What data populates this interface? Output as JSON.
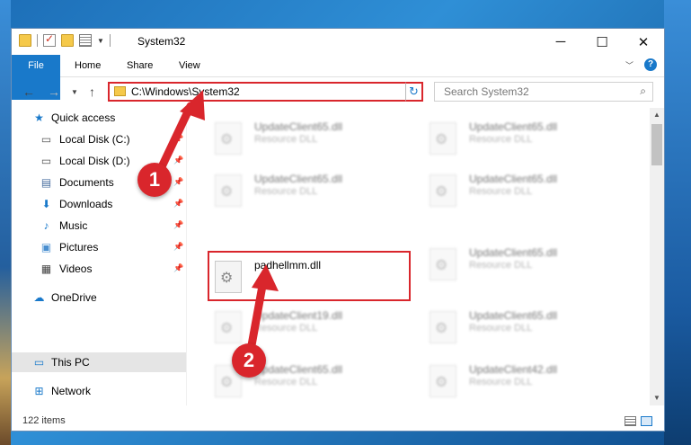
{
  "window": {
    "title": "System32",
    "controls": {
      "minimize": "─",
      "maximize": "☐",
      "close": "✕"
    }
  },
  "ribbon": {
    "tabs": [
      {
        "label": "File"
      },
      {
        "label": "Home"
      },
      {
        "label": "Share"
      },
      {
        "label": "View"
      }
    ],
    "help": "?"
  },
  "nav": {
    "address": "C:\\Windows\\System32",
    "search_placeholder": "Search System32"
  },
  "sidebar": {
    "items": [
      {
        "label": "Quick access",
        "icon": "star-icon",
        "pinned": false
      },
      {
        "label": "Local Disk (C:)",
        "icon": "drive-icon",
        "pinned": true
      },
      {
        "label": "Local Disk (D:)",
        "icon": "drive-icon",
        "pinned": true
      },
      {
        "label": "Documents",
        "icon": "documents-icon",
        "pinned": true
      },
      {
        "label": "Downloads",
        "icon": "download-arrow-icon",
        "pinned": true
      },
      {
        "label": "Music",
        "icon": "music-note-icon",
        "pinned": true
      },
      {
        "label": "Pictures",
        "icon": "pictures-icon",
        "pinned": true
      },
      {
        "label": "Videos",
        "icon": "film-icon",
        "pinned": true
      },
      {
        "label": "OneDrive",
        "icon": "cloud-icon",
        "pinned": false
      },
      {
        "label": "This PC",
        "icon": "monitor-icon",
        "pinned": false,
        "selected": true
      },
      {
        "label": "Network",
        "icon": "network-icon",
        "pinned": false
      }
    ]
  },
  "files": [
    {
      "name": "UpdateClient65.dll",
      "type": "Resource DLL"
    },
    {
      "name": "UpdateClient65.dll",
      "type": "Resource DLL"
    },
    {
      "name": "UpdateClient65.dll",
      "type": "Resource DLL"
    },
    {
      "name": "UpdateClient65.dll",
      "type": "Resource DLL"
    },
    {
      "name": "padhellmm.dll",
      "type": ""
    },
    {
      "name": "UpdateClient65.dll",
      "type": "Resource DLL"
    },
    {
      "name": "UpdateClient19.dll",
      "type": "Resource DLL"
    },
    {
      "name": "UpdateClient65.dll",
      "type": "Resource DLL"
    },
    {
      "name": "UpdateClient65.dll",
      "type": "Resource DLL"
    },
    {
      "name": "UpdateClient42.dll",
      "type": "Resource DLL"
    }
  ],
  "status": {
    "item_count": "122 items"
  },
  "callouts": [
    {
      "label": "1"
    },
    {
      "label": "2"
    }
  ],
  "colors": {
    "accent": "#1979ca",
    "callout": "#d9262c"
  }
}
